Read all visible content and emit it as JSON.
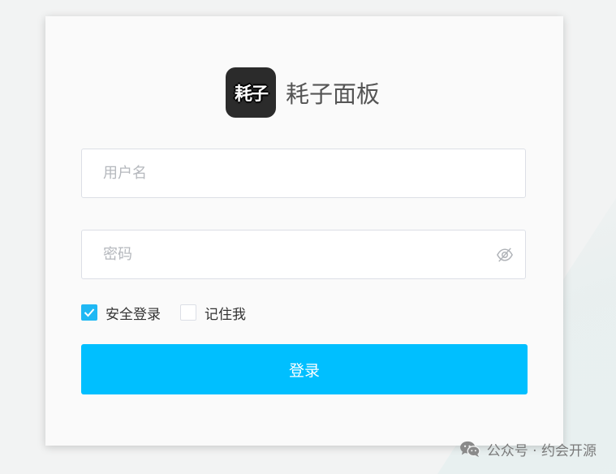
{
  "brand": {
    "logo_text": "耗子",
    "title": "耗子面板"
  },
  "form": {
    "username_placeholder": "用户名",
    "password_placeholder": "密码",
    "secure_login_label": "安全登录",
    "secure_login_checked": true,
    "remember_me_label": "记住我",
    "remember_me_checked": false,
    "login_button_label": "登录"
  },
  "watermark": {
    "text": "公众号 · 约会开源"
  },
  "colors": {
    "accent": "#00bfff",
    "checkbox": "#1fb8f4",
    "logo_bg": "#2b2b2b"
  },
  "icons": {
    "password_toggle": "eye-slash-icon",
    "watermark": "wechat-icon"
  }
}
